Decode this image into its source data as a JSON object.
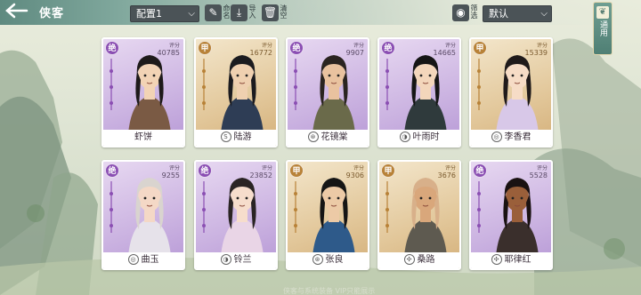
{
  "header": {
    "back_icon": "back-arrow-icon",
    "title": "侠客",
    "config_select": {
      "value": "配置1"
    },
    "edit_label": "命名",
    "import_label": "导入",
    "clear_label": "清空",
    "filter_label": "筛选",
    "sort_select": {
      "value": "默认"
    },
    "side_tab_label": "通用"
  },
  "colors": {
    "purple_rank": "#8b4fb3",
    "gold_rank": "#b88238",
    "topbar": "#5f8a80"
  },
  "cards": [
    {
      "name": "虾饼",
      "rank": "绝",
      "grade": "purple",
      "score_label": "评分",
      "score": "40785",
      "sect": false
    },
    {
      "name": "陆游",
      "rank": "甲",
      "grade": "gold",
      "score_label": "评分",
      "score": "16772",
      "sect": true,
      "sect_symbol": "S"
    },
    {
      "name": "花镜棠",
      "rank": "绝",
      "grade": "purple",
      "score_label": "评分",
      "score": "9907",
      "sect": true,
      "sect_symbol": "⊛"
    },
    {
      "name": "叶雨时",
      "rank": "绝",
      "grade": "purple",
      "score_label": "评分",
      "score": "14665",
      "sect": true,
      "sect_symbol": "◑"
    },
    {
      "name": "李香君",
      "rank": "甲",
      "grade": "gold",
      "score_label": "评分",
      "score": "15339",
      "sect": true,
      "sect_symbol": "◎"
    },
    {
      "name": "曲玉",
      "rank": "绝",
      "grade": "purple",
      "score_label": "评分",
      "score": "9255",
      "sect": true,
      "sect_symbol": "◎"
    },
    {
      "name": "铃兰",
      "rank": "绝",
      "grade": "purple",
      "score_label": "评分",
      "score": "23852",
      "sect": true,
      "sect_symbol": "◑"
    },
    {
      "name": "张良",
      "rank": "甲",
      "grade": "gold",
      "score_label": "评分",
      "score": "9306",
      "sect": true,
      "sect_symbol": "⊛"
    },
    {
      "name": "桑路",
      "rank": "甲",
      "grade": "gold",
      "score_label": "评分",
      "score": "3676",
      "sect": true,
      "sect_symbol": "✣"
    },
    {
      "name": "耶律红",
      "rank": "绝",
      "grade": "purple",
      "score_label": "评分",
      "score": "5528",
      "sect": true,
      "sect_symbol": "✣"
    }
  ],
  "footer": {
    "text": "侠客与系统装备 VIP只能展示"
  }
}
